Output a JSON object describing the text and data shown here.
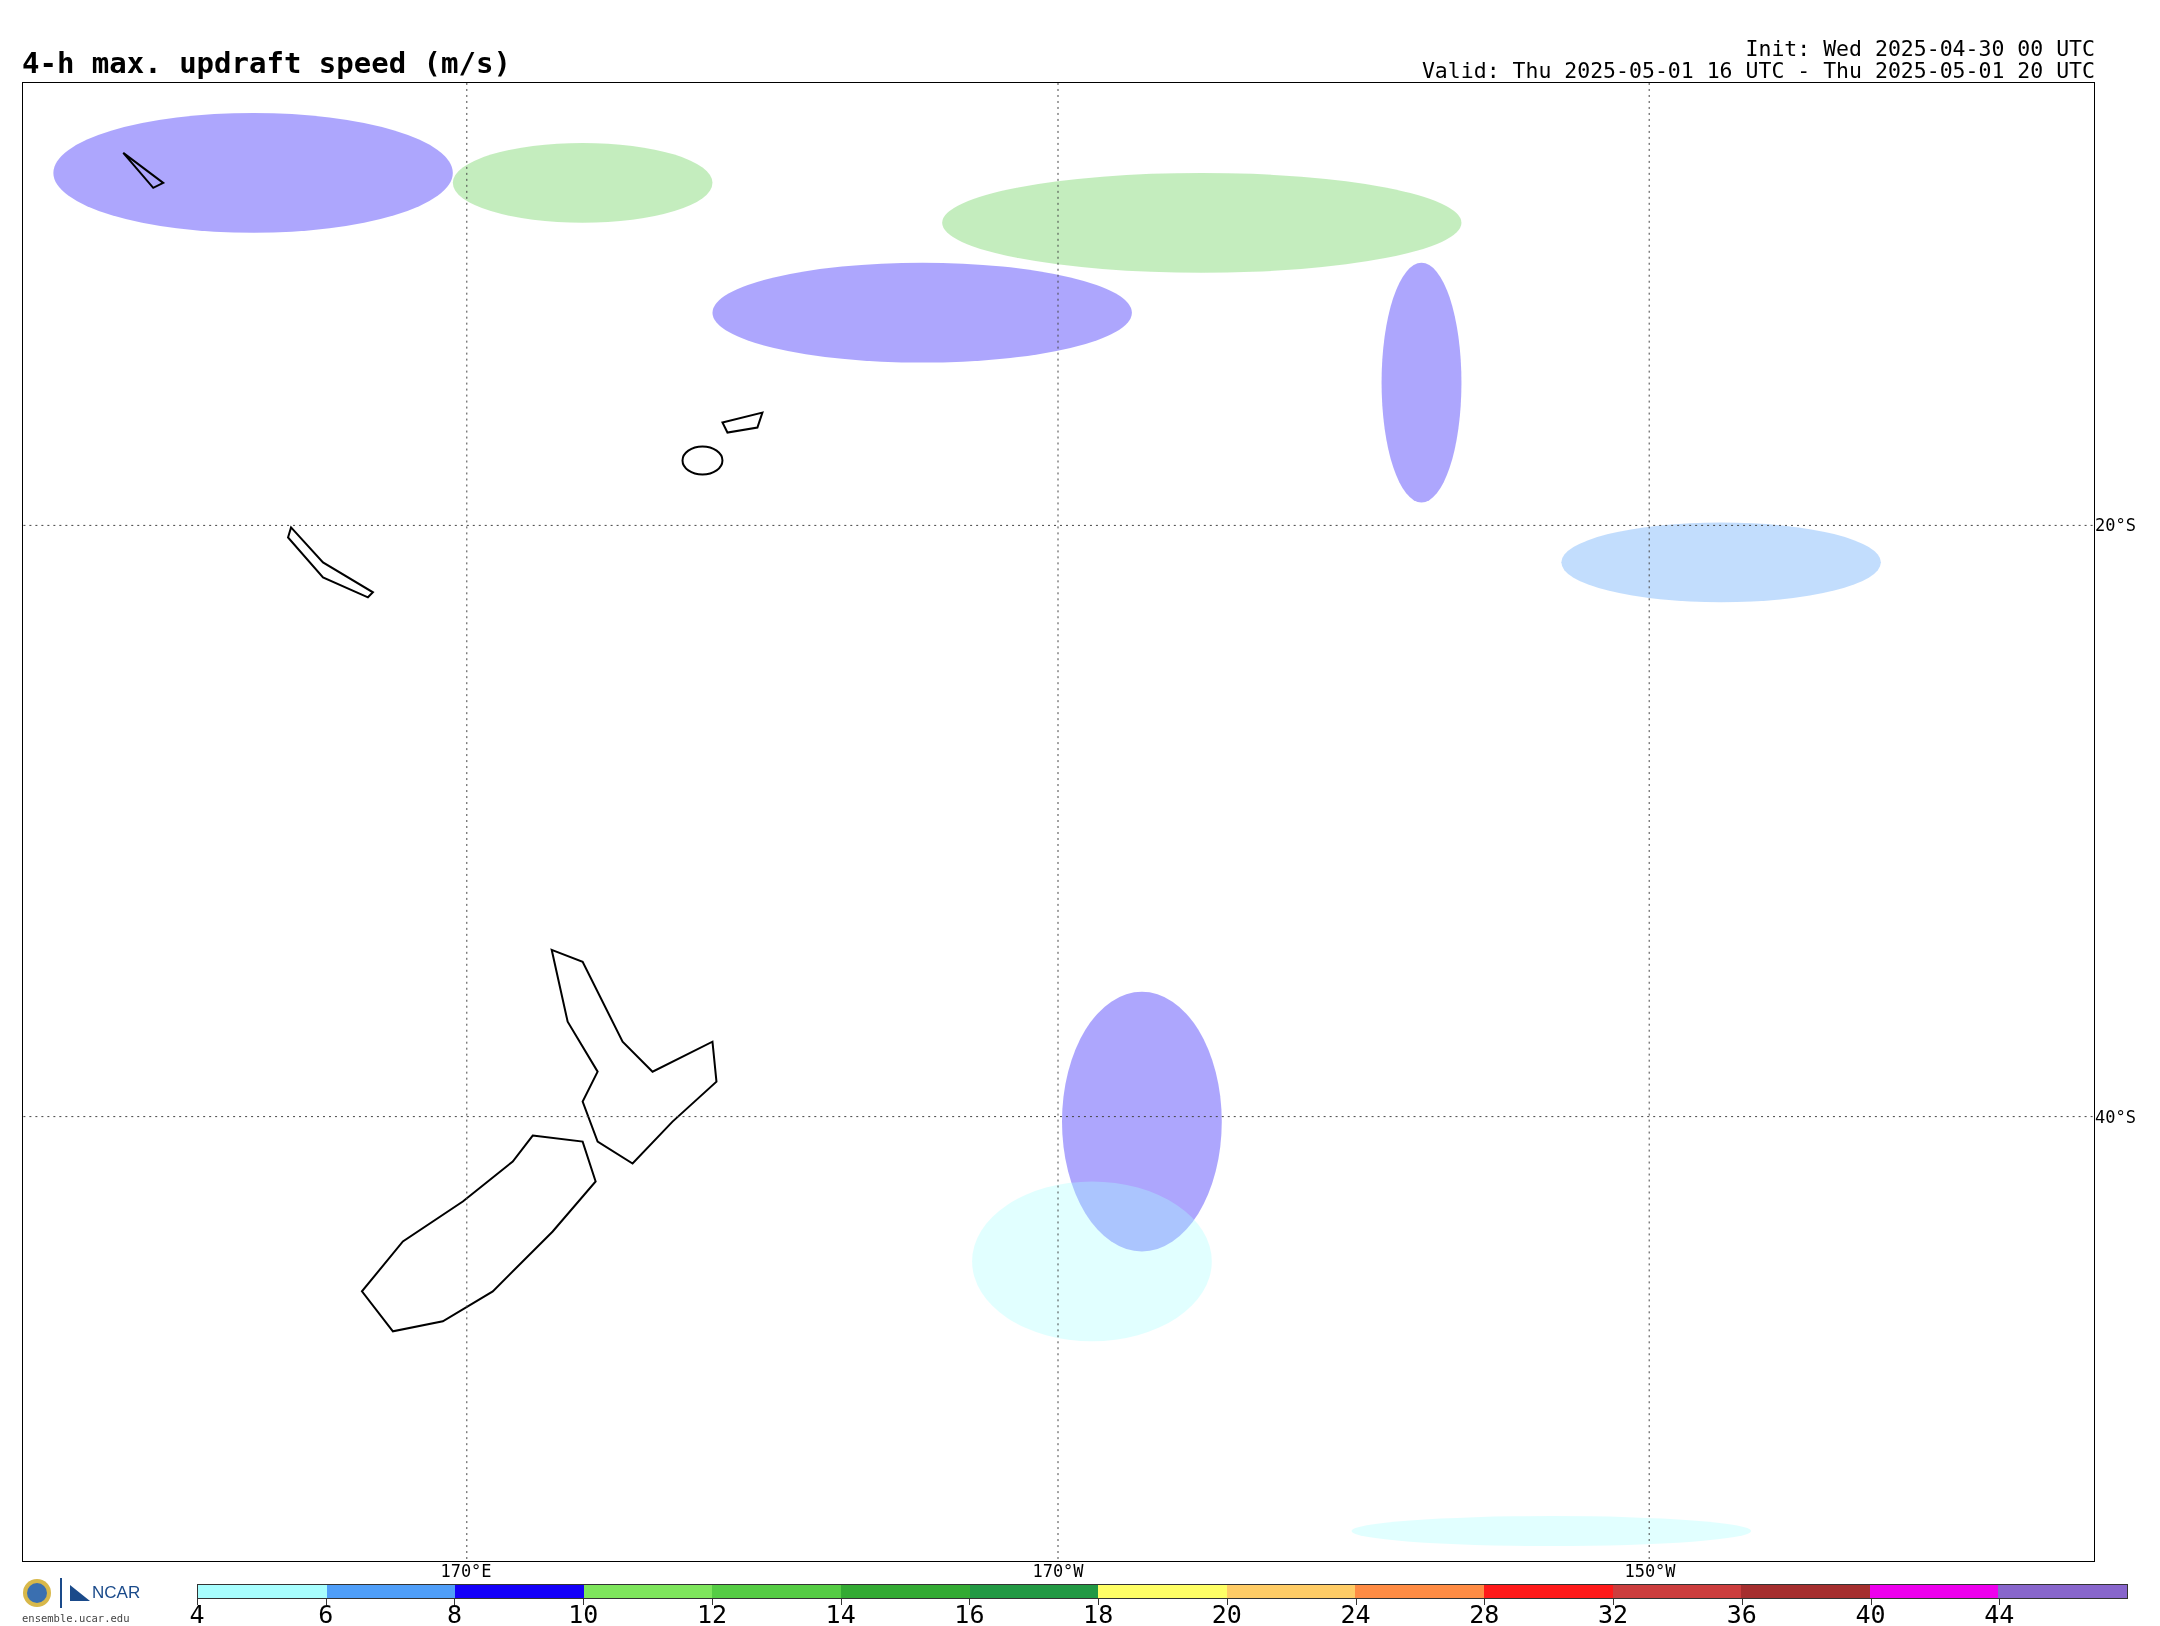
{
  "title": "4-h max. updraft speed (m/s)",
  "init": "Init: Wed 2025-04-30 00 UTC",
  "valid": "Valid: Thu 2025-05-01 16 UTC - Thu 2025-05-01 20 UTC",
  "map": {
    "lat_labels": [
      "20°S",
      "40°S"
    ],
    "lon_labels": [
      "170°E",
      "170°W",
      "150°W"
    ]
  },
  "logo": {
    "site": "ensemble.ucar.edu",
    "org": "NCAR"
  },
  "colorbar": [
    {
      "label": "4",
      "color": "#a8fefe"
    },
    {
      "label": "6",
      "color": "#4f9ef8"
    },
    {
      "label": "8",
      "color": "#1400f8"
    },
    {
      "label": "10",
      "color": "#7ee55c"
    },
    {
      "label": "12",
      "color": "#55cc44"
    },
    {
      "label": "14",
      "color": "#33aa33"
    },
    {
      "label": "16",
      "color": "#229944"
    },
    {
      "label": "18",
      "color": "#ffff66"
    },
    {
      "label": "20",
      "color": "#ffcc66"
    },
    {
      "label": "24",
      "color": "#ff8c44"
    },
    {
      "label": "28",
      "color": "#ff1a1a"
    },
    {
      "label": "32",
      "color": "#cc3d3d"
    },
    {
      "label": "36",
      "color": "#a52e2e"
    },
    {
      "label": "40",
      "color": "#ee00ee"
    },
    {
      "label": "44",
      "color": "#8866cc"
    }
  ]
}
